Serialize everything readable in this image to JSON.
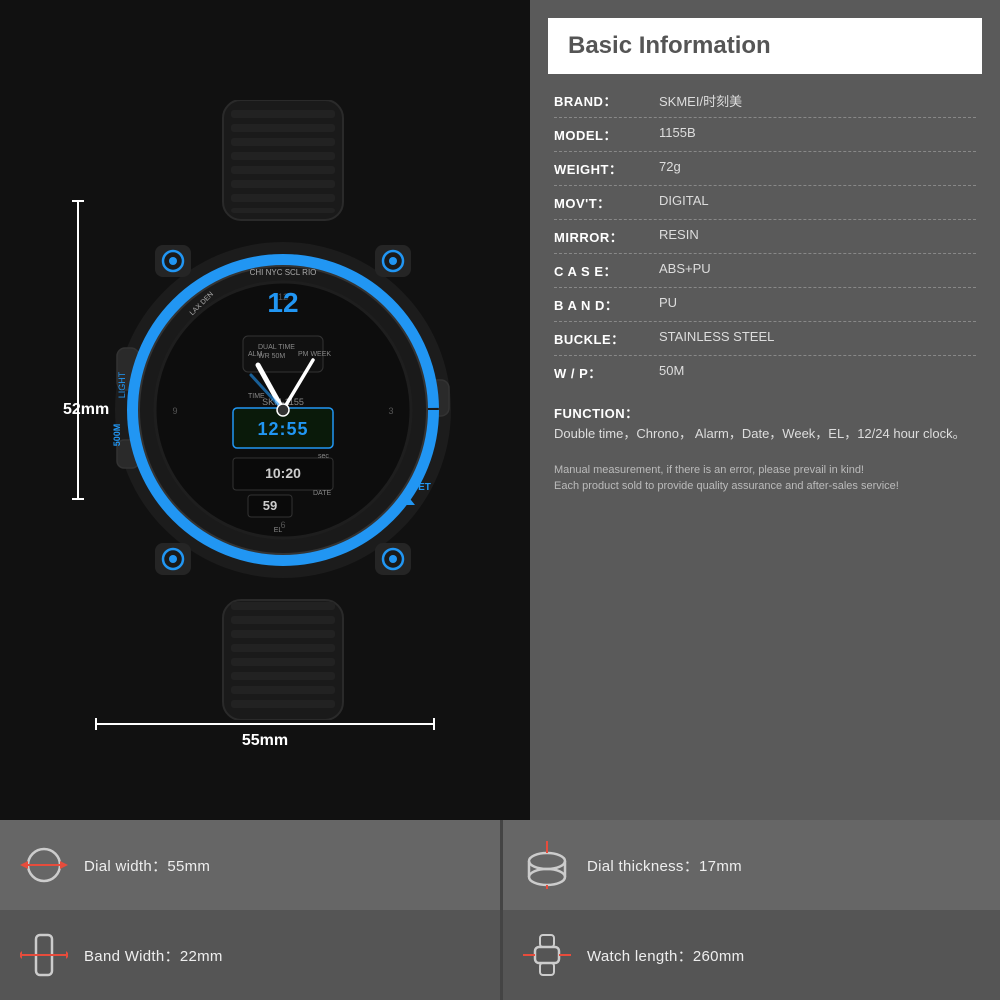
{
  "header": {
    "title": "Basic Information"
  },
  "specs": [
    {
      "label": "BRAND：",
      "value": "SKMEI/时刻美"
    },
    {
      "label": "MODEL：",
      "value": "1155B"
    },
    {
      "label": "WEIGHT：",
      "value": "72g"
    },
    {
      "label": "MOV'T：",
      "value": "DIGITAL"
    },
    {
      "label": "MIRROR：",
      "value": "RESIN"
    },
    {
      "label": "C A S E：",
      "value": "ABS+PU"
    },
    {
      "label": "B A N D：",
      "value": "PU"
    },
    {
      "label": "BUCKLE：",
      "value": "STAINLESS STEEL"
    },
    {
      "label": "W / P：",
      "value": "50M"
    }
  ],
  "function": {
    "label": "FUNCTION：",
    "value": "Double time，Chrono，\nAlarm，Date，Week，EL，12/24 hour clock。"
  },
  "note": "Manual measurement, if there is an error, please prevail in kind!\nEach product sold to provide quality assurance and after-sales service!",
  "dimensions": {
    "height_label": "52mm",
    "width_label": "55mm"
  },
  "bottom": [
    {
      "icon": "dial-width-icon",
      "text": "Dial width：55mm"
    },
    {
      "icon": "dial-thickness-icon",
      "text": "Dial thickness：17mm"
    },
    {
      "icon": "band-width-icon",
      "text": "Band Width：22mm"
    },
    {
      "icon": "watch-length-icon",
      "text": "Watch length：260mm"
    }
  ],
  "colors": {
    "accent": "#2196F3",
    "bg_dark": "#111111",
    "bg_panel": "#5a5a5a",
    "bg_bottom1": "#666666",
    "bg_bottom2": "#555555"
  }
}
